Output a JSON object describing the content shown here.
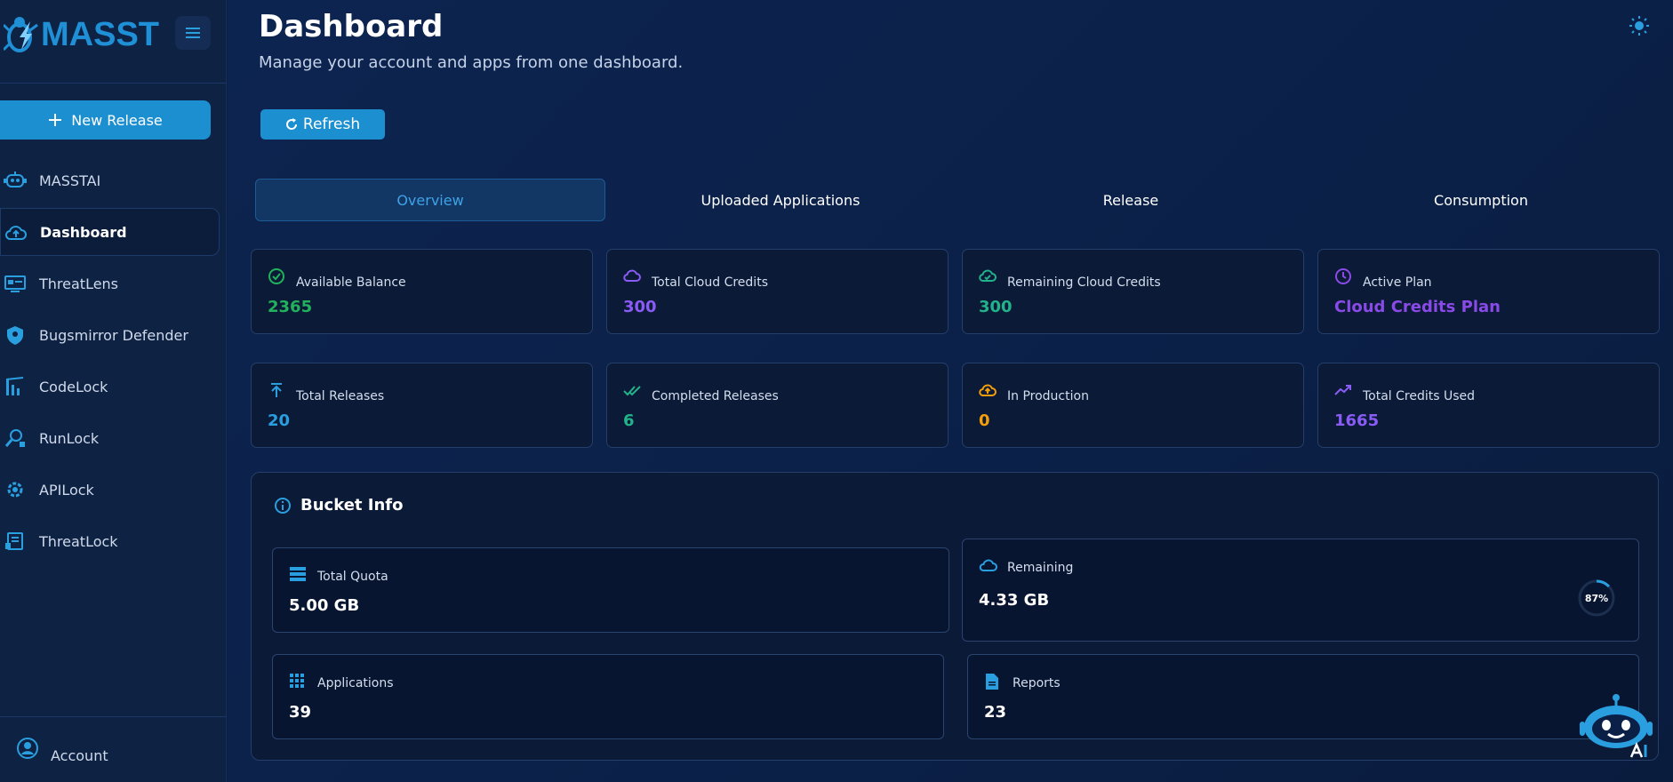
{
  "brand": {
    "name": "MASST"
  },
  "sidebar": {
    "new_release_label": "New Release",
    "items": [
      {
        "label": "MASSTAI",
        "icon": "robot-icon"
      },
      {
        "label": "Dashboard",
        "icon": "cloud-upload-icon",
        "active": true
      },
      {
        "label": "ThreatLens",
        "icon": "threatlens-icon"
      },
      {
        "label": "Bugsmirror Defender",
        "icon": "shield-icon"
      },
      {
        "label": "CodeLock",
        "icon": "codelock-icon"
      },
      {
        "label": "RunLock",
        "icon": "runlock-icon"
      },
      {
        "label": "APILock",
        "icon": "apilock-icon"
      },
      {
        "label": "ThreatLock",
        "icon": "threatlock-icon"
      }
    ],
    "account_label": "Account"
  },
  "header": {
    "title": "Dashboard",
    "subtitle": "Manage your account and apps from one dashboard.",
    "refresh_label": "Refresh"
  },
  "tabs": [
    {
      "label": "Overview",
      "active": true
    },
    {
      "label": "Uploaded Applications"
    },
    {
      "label": "Release"
    },
    {
      "label": "Consumption"
    }
  ],
  "stats": [
    {
      "label": "Available Balance",
      "value": "2365",
      "color": "#22b15c",
      "icon": "check-circle-icon"
    },
    {
      "label": "Total Cloud Credits",
      "value": "300",
      "color": "#8a5cf6",
      "icon": "cloud-icon"
    },
    {
      "label": "Remaining Cloud Credits",
      "value": "300",
      "color": "#22b38a",
      "icon": "cloud-check-icon"
    },
    {
      "label": "Active Plan",
      "value": "Cloud Credits Plan",
      "color": "#8a4ae8",
      "icon": "clock-icon"
    },
    {
      "label": "Total Releases",
      "value": "20",
      "color": "#2a9fe0",
      "icon": "upload-arrow-icon"
    },
    {
      "label": "Completed Releases",
      "value": "6",
      "color": "#22b38a",
      "icon": "double-check-icon"
    },
    {
      "label": "In Production",
      "value": "0",
      "color": "#f59e0b",
      "icon": "cloud-upload-icon"
    },
    {
      "label": "Total Credits Used",
      "value": "1665",
      "color": "#8a5cf6",
      "icon": "trending-up-icon"
    }
  ],
  "bucket": {
    "title": "Bucket Info",
    "total_quota": {
      "label": "Total Quota",
      "value": "5.00 GB"
    },
    "remaining": {
      "label": "Remaining",
      "value": "4.33 GB",
      "percent_label": "87%",
      "percent": 0.87
    },
    "applications": {
      "label": "Applications",
      "value": "39"
    },
    "reports": {
      "label": "Reports",
      "value": "23"
    }
  }
}
